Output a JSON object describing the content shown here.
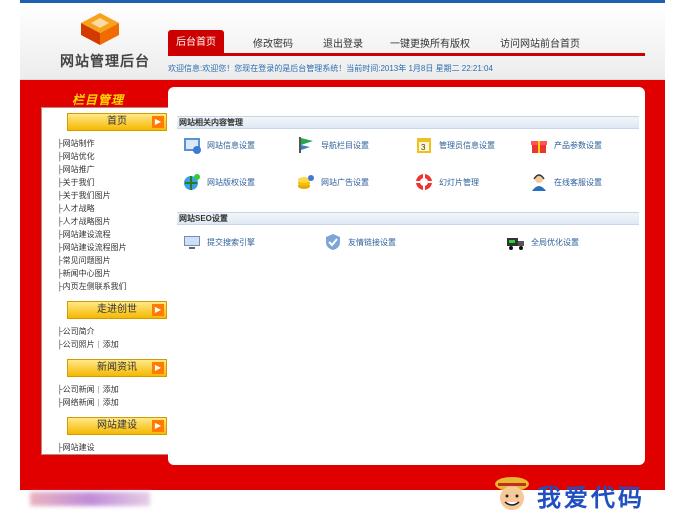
{
  "header": {
    "logo_text": "网站管理后台",
    "nav": [
      {
        "label": "后台首页"
      },
      {
        "label": "修改密码"
      },
      {
        "label": "退出登录"
      },
      {
        "label": "一键更换所有版权"
      },
      {
        "label": "访问网站前台首页"
      }
    ],
    "welcome": "欢迎信息:欢迎您！您现在登录的是后台管理系统！当前时间:2013年 1月8日 星期二 22:21:04"
  },
  "sidebar": {
    "title": "栏目管理",
    "groups": [
      {
        "label": "首页",
        "items": [
          {
            "label": "网站制作"
          },
          {
            "label": "网站优化"
          },
          {
            "label": "网站推广"
          },
          {
            "label": "关于我们"
          },
          {
            "label": "关于我们图片"
          },
          {
            "label": "人才战略"
          },
          {
            "label": "人才战略图片"
          },
          {
            "label": "网站建设流程"
          },
          {
            "label": "网站建设流程图片"
          },
          {
            "label": "常见问题图片"
          },
          {
            "label": "新闻中心图片"
          },
          {
            "label": "内页左侧联系我们"
          }
        ]
      },
      {
        "label": "走进创世",
        "items": [
          {
            "label": "公司简介",
            "action": ""
          },
          {
            "label": "公司照片",
            "action": "添加"
          }
        ]
      },
      {
        "label": "新闻资讯",
        "items": [
          {
            "label": "公司新闻",
            "action": "添加"
          },
          {
            "label": "网络新闻",
            "action": "添加"
          }
        ]
      },
      {
        "label": "网站建设",
        "items": [
          {
            "label": "网站建设"
          }
        ]
      }
    ]
  },
  "content": {
    "sections": [
      {
        "title": "网站相关内容管理",
        "tiles": [
          {
            "label": "网站信息设置",
            "icon": "site-info-icon"
          },
          {
            "label": "导航栏目设置",
            "icon": "nav-flag-icon"
          },
          {
            "label": "管理员信息设置",
            "icon": "admin-calendar-icon"
          },
          {
            "label": "产品参数设置",
            "icon": "gift-icon"
          },
          {
            "label": "网站版权设置",
            "icon": "globe-pin-icon"
          },
          {
            "label": "网站广告设置",
            "icon": "coins-icon"
          },
          {
            "label": "幻灯片管理",
            "icon": "lifebuoy-icon"
          },
          {
            "label": "在线客服设置",
            "icon": "support-agent-icon"
          }
        ]
      },
      {
        "title": "网站SEO设置",
        "tiles": [
          {
            "label": "提交搜索引擎",
            "icon": "monitor-icon"
          },
          {
            "label": "友情链接设置",
            "icon": "shield-link-icon"
          },
          {
            "label": "全局优化设置",
            "icon": "truck-icon"
          }
        ]
      }
    ]
  },
  "watermark": {
    "text": "我爱代码"
  },
  "colors": {
    "brand_red": "#e00000",
    "link_blue": "#2b5f9a",
    "accent_yellow": "#ffd800"
  }
}
